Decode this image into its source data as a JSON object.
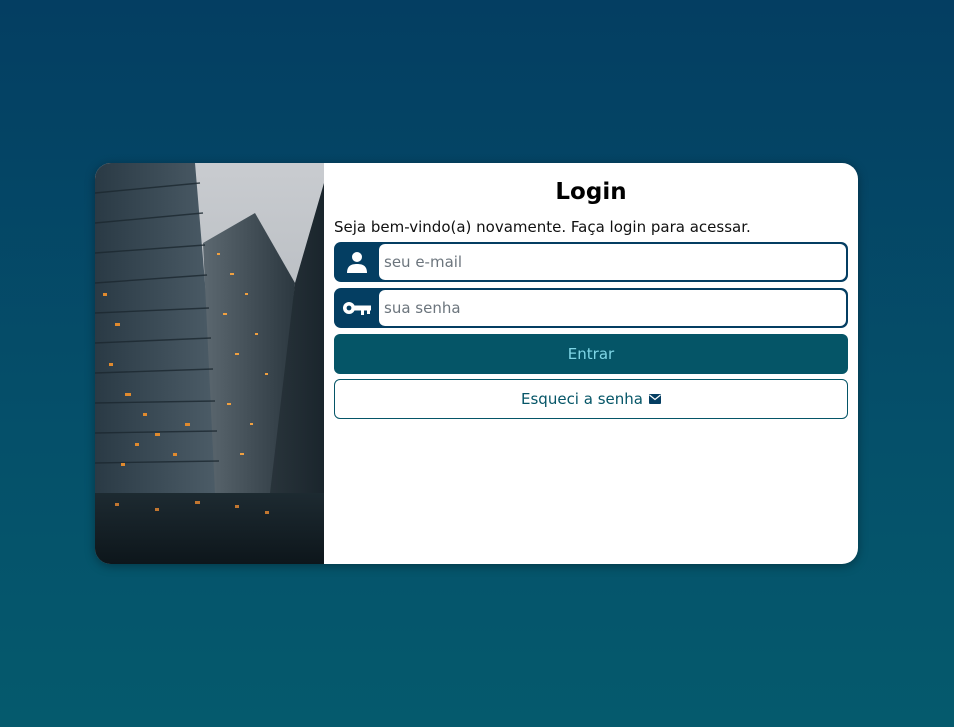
{
  "login": {
    "title": "Login",
    "subtitle": "Seja bem-vindo(a) novamente. Faça login para acessar.",
    "email_placeholder": "seu e-mail",
    "password_placeholder": "sua senha",
    "submit_label": "Entrar",
    "forgot_label": "Esqueci a senha"
  },
  "icons": {
    "email": "user-icon",
    "password": "key-icon",
    "forgot": "envelope-icon"
  },
  "colors": {
    "background_top": "#043e62",
    "background_bottom": "#055a6d",
    "accent": "#043e62",
    "button": "#055567",
    "button_text": "#7fd6e6"
  }
}
